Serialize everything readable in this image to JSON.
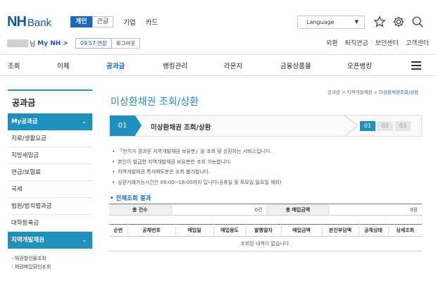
{
  "header": {
    "logo_nh": "NH",
    "logo_bank": "Bank",
    "user_tabs": [
      "개인",
      "큰글"
    ],
    "user_links": [
      "기업",
      "카드"
    ],
    "language": "Language",
    "account_suffix": "님",
    "my_nh": "My NH >",
    "session_time": "09:57 연장",
    "logout": "로그아웃",
    "right_links": [
      "외환",
      "퇴직연금",
      "보안센터",
      "고객센터"
    ]
  },
  "gnb": {
    "items": [
      "조회",
      "이체",
      "공과금",
      "뱅킹관리",
      "라운지",
      "금융상품몰",
      "오픈뱅킹"
    ],
    "active_index": 2
  },
  "sidebar": {
    "title": "공과금",
    "items": [
      {
        "label": "My공과금",
        "chev": "⌄"
      },
      {
        "label": "지로/생활요금"
      },
      {
        "label": "지방세입금"
      },
      {
        "label": "연금/보험료"
      },
      {
        "label": "국세"
      },
      {
        "label": "법원/범칙벌과금"
      },
      {
        "label": "대학등록금"
      },
      {
        "label": "지역개발채권",
        "chev": "⌄"
      }
    ],
    "sub_items": [
      "- 채권할인률조회",
      "- 채권매입확인조회"
    ]
  },
  "breadcrumb": {
    "items": [
      "공과금",
      "지역개발채권"
    ],
    "current": "미상환채권조회/상환"
  },
  "page_title": "미상환채권 조회/상환",
  "step": {
    "num": "01",
    "label": "미상환채권 조회/상환",
    "badges": [
      "01",
      "02",
      "03"
    ],
    "active": 0
  },
  "notes": [
    "「만기가 경과된 지역개발채권 보유분」을 조회 및 상환하는 서비스입니다.",
    "본인이 발급한 지역개발채권 보유분만 조회 가능합니다.",
    "지역개발채권 특서매도분은 조회 불가합니다.",
    "상환거래가능시간은 09:00~18:00까지 입니다(공휴일 및 토요일,일요일 제외)"
  ],
  "result": {
    "title": "전체조회 결과",
    "summary": [
      {
        "label": "총 건수",
        "value": "0건"
      },
      {
        "label": "총 매입금액",
        "value": "0원"
      }
    ],
    "columns": [
      "순번",
      "공채번호",
      "매입일",
      "매입용도",
      "발행일자",
      "매입금액",
      "본인부담액",
      "공채상태",
      "상세조회"
    ],
    "empty": "조회된 내역이 없습니다."
  },
  "colors": {
    "brand": "#0d5ba7",
    "accent": "#1f8fbc"
  }
}
